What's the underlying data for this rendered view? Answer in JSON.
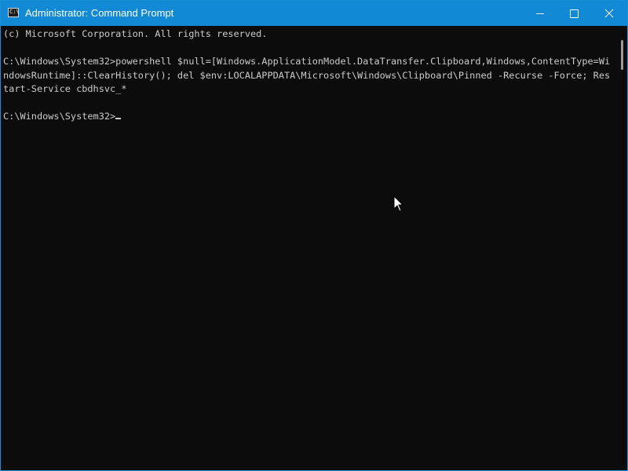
{
  "window": {
    "title": "Administrator: Command Prompt",
    "accent_color": "#1289d4",
    "icon": "command-prompt-icon",
    "icon_glyph": "C:\\",
    "controls": {
      "minimize": "minimize-icon",
      "maximize": "maximize-icon",
      "close": "close-icon"
    }
  },
  "console": {
    "background": "#0c0c0c",
    "foreground": "#cccccc",
    "lines": [
      "(c) Microsoft Corporation. All rights reserved.",
      "",
      "C:\\Windows\\System32>powershell $null=[Windows.ApplicationModel.DataTransfer.Clipboard,Windows,ContentType=Wi",
      "ndowsRuntime]::ClearHistory(); del $env:LOCALAPPDATA\\Microsoft\\Windows\\Clipboard\\Pinned -Recurse -Force; Res",
      "tart-Service cbdhsvc_*",
      ""
    ],
    "prompt": "C:\\Windows\\System32>"
  }
}
